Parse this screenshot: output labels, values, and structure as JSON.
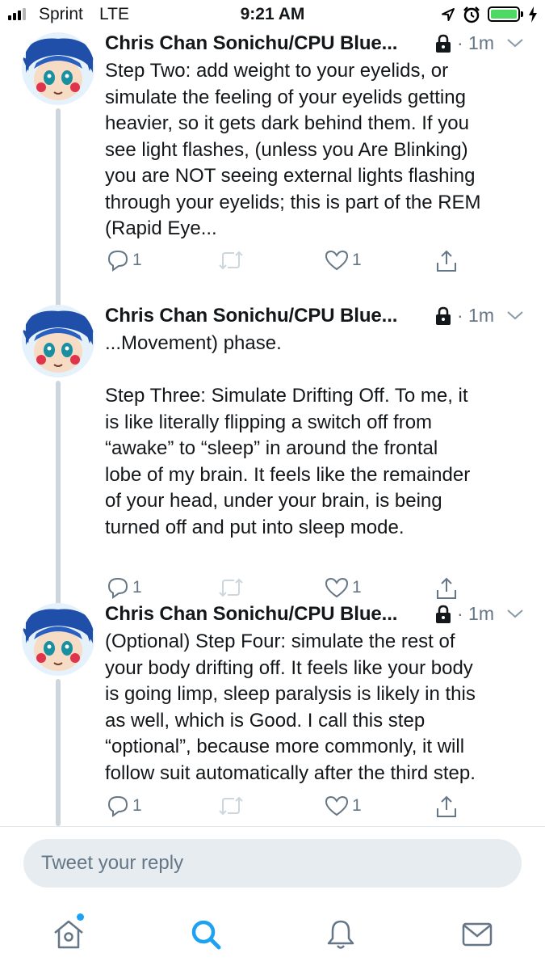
{
  "status_bar": {
    "carrier": "Sprint",
    "network": "LTE",
    "time": "9:21 AM",
    "battery_level": 1.0,
    "battery_color": "#4cd964",
    "icons": [
      "signal-icon",
      "location-icon",
      "alarm-icon",
      "battery-icon",
      "charging-icon"
    ]
  },
  "thread": {
    "line_color": "#cdd6dd",
    "tweets": [
      {
        "author": "Chris Chan Sonichu/CPU Blue...",
        "time": "· 1m",
        "text_lines": [
          "Step Two: add weight to your eyelids, or",
          "simulate the feeling of your eyelids getting",
          "heavier, so it gets dark behind them. If you",
          "see light flashes, (unless you Are Blinking)",
          "you are NOT seeing external lights flashing",
          "through your eyelids; this is part of the REM",
          "(Rapid Eye..."
        ],
        "replies": "1",
        "likes": "1"
      },
      {
        "author": "Chris Chan Sonichu/CPU Blue...",
        "time": "· 1m",
        "text_lines": [
          "...Movement) phase.",
          "",
          "Step Three: Simulate Drifting Off. To me, it",
          "is like literally flipping a switch off from",
          "“awake” to “sleep” in around the frontal",
          "lobe of my brain. It feels like the remainder",
          "of your head, under your brain, is being",
          "turned off and put into sleep mode."
        ],
        "replies": "1",
        "likes": "1"
      },
      {
        "author": "Chris Chan Sonichu/CPU Blue...",
        "time": "· 1m",
        "text_lines": [
          "(Optional) Step Four: simulate the rest of",
          "your body drifting off. It feels like your body",
          "is going limp, sleep paralysis is likely in this",
          "as well, which is Good. I call this step",
          "“optional”, because more commonly, it will",
          "follow suit automatically after the third step."
        ],
        "replies": "1",
        "likes": "1"
      }
    ]
  },
  "reply": {
    "placeholder": "Tweet your reply"
  },
  "tabbar": {
    "active_color": "#1da1f2",
    "inactive_color": "#657786",
    "tabs": [
      "home-icon",
      "search-icon",
      "notifications-icon",
      "messages-icon"
    ],
    "active_tab": "search-icon",
    "home_has_new": true
  }
}
